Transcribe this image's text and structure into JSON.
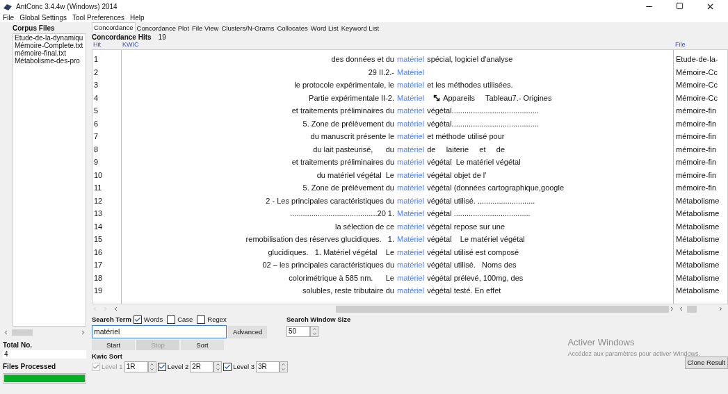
{
  "window": {
    "title": "AntConc 3.4.4w (Windows) 2014"
  },
  "menu": [
    "File",
    "Global Settings",
    "Tool Preferences",
    "Help"
  ],
  "sidebar": {
    "title": "Corpus Files",
    "files": [
      "Etude-de-la-dynamiqu",
      "Mémoire-Complete.txt",
      "mémoire-final.txt",
      "Métabolisme-des-pro"
    ],
    "total_label": "Total No.",
    "total": "4",
    "processed_label": "Files Processed",
    "progress": {
      "level": 1
    }
  },
  "tabs": [
    {
      "label": "Concordance",
      "selected": true
    },
    {
      "label": "Concordance Plot",
      "selected": false
    },
    {
      "label": "File View",
      "selected": false
    },
    {
      "label": "Clusters/N-Grams",
      "selected": false
    },
    {
      "label": "Collocates",
      "selected": false
    },
    {
      "label": "Word List",
      "selected": false
    },
    {
      "label": "Keyword List",
      "selected": false
    }
  ],
  "hits_label": "Concordance Hits",
  "hits": "19",
  "table": {
    "columns": [
      "Hit",
      "KWIC",
      "File"
    ],
    "rows": [
      {
        "hit": "1",
        "left": "des données et du",
        "kw": "matériel",
        "right": "spécial, logiciel d'analyse",
        "file": "Etude-de-la-",
        "icon": false
      },
      {
        "hit": "2",
        "left": "29 II.2.-",
        "kw": "Matériel",
        "right": "",
        "file": "Mémoire-Cc",
        "icon": false
      },
      {
        "hit": "3",
        "left": "le protocole expérimentale, le",
        "kw": "matériel",
        "right": "et les méthodes utilisées.",
        "file": "Mémoire-Cc",
        "icon": false
      },
      {
        "hit": "4",
        "left": "Partie expérimentale II-2.",
        "kw": "Matériel",
        "right": "Appareils     Tableau7.- Origines",
        "file": "Mémoire-Cc",
        "icon": true
      },
      {
        "hit": "5",
        "left": "et traitements préliminaires du",
        "kw": "matériel",
        "right": "végétal.........................................",
        "file": "mémoire-fin",
        "icon": false
      },
      {
        "hit": "6",
        "left": "5. Zone de prélèvement du",
        "kw": "matériel",
        "right": "végétal.........................................",
        "file": "mémoire-fin",
        "icon": false
      },
      {
        "hit": "7",
        "left": "du manuscrit présente le",
        "kw": "matériel",
        "right": "et méthode utilisé pour",
        "file": "mémoire-fin",
        "icon": false
      },
      {
        "hit": "8",
        "left": "du lait pasteurisé,      du",
        "kw": "matériel",
        "right": "de     laiterie     et     de",
        "file": "mémoire-fin",
        "icon": false
      },
      {
        "hit": "9",
        "left": "et traitements préliminaires du",
        "kw": "matériel",
        "right": "végétal  Le matériel végétal",
        "file": "mémoire-fin",
        "icon": false
      },
      {
        "hit": "10",
        "left": "du matériel végétal  Le",
        "kw": "matériel",
        "right": "végétal objet de l'",
        "file": "mémoire-fin",
        "icon": false
      },
      {
        "hit": "11",
        "left": "5. Zone de prélèvement du",
        "kw": "matériel",
        "right": "végétal (données cartographique,google",
        "file": "mémoire-fin",
        "icon": false
      },
      {
        "hit": "12",
        "left": "2 - Les principales caractéristiques du",
        "kw": "matériel",
        "right": "végétal utilisé. ...........................",
        "file": "Métabolisme",
        "icon": false
      },
      {
        "hit": "13",
        "left": ".........................................20 1.",
        "kw": "Matériel",
        "right": "végétal ....................................",
        "file": "Métabolisme",
        "icon": false
      },
      {
        "hit": "14",
        "left": "la sélection de ce",
        "kw": "matériel",
        "right": "végétal repose sur une",
        "file": "Métabolisme",
        "icon": false
      },
      {
        "hit": "15",
        "left": "remobilisation des réserves glucidiques.   1.",
        "kw": "Matériel",
        "right": "végétal    Le matériel végétal",
        "file": "Métabolisme",
        "icon": false
      },
      {
        "hit": "16",
        "left": "glucidiques.   1. Matériel végétal    Le",
        "kw": "matériel",
        "right": "végétal utilisé est composé",
        "file": "Métabolisme",
        "icon": false
      },
      {
        "hit": "17",
        "left": "02 – les principales caractéristiques du",
        "kw": "matériel",
        "right": "végétal utilisé.   Noms des",
        "file": "Métabolisme",
        "icon": false
      },
      {
        "hit": "18",
        "left": "colorimétrique à 585 nm.      Le",
        "kw": "matériel",
        "right": "végétal prélevé, 100mg, des",
        "file": "Métabolisme",
        "icon": false
      },
      {
        "hit": "19",
        "left": "solubles, reste tributaire du",
        "kw": "matériel",
        "right": "végétal testé. En effet",
        "file": "Métabolisme",
        "icon": false
      }
    ]
  },
  "search": {
    "label": "Search Term",
    "options": [
      {
        "label": "Words",
        "checked": true
      },
      {
        "label": "Case",
        "checked": false
      },
      {
        "label": "Regex",
        "checked": false
      }
    ],
    "value": "matériel",
    "advanced": "Advanced",
    "window_label": "Search Window Size",
    "window_size": "50"
  },
  "buttons": [
    {
      "label": "Start",
      "disabled": false
    },
    {
      "label": "Stop",
      "disabled": true
    },
    {
      "label": "Sort",
      "disabled": false
    }
  ],
  "kwic_sort": {
    "label": "Kwic Sort",
    "levels": [
      {
        "label": "Level 1",
        "value": "1R",
        "checked": true,
        "disabled": true
      },
      {
        "label": "Level 2",
        "value": "2R",
        "checked": true,
        "disabled": false
      },
      {
        "label": "Level 3",
        "value": "3R",
        "checked": true,
        "disabled": false
      }
    ]
  },
  "activation": {
    "title": "Activer Windows",
    "text": "Accédez aux paramètres pour activer Windows."
  },
  "clone_button": "Clone Result"
}
